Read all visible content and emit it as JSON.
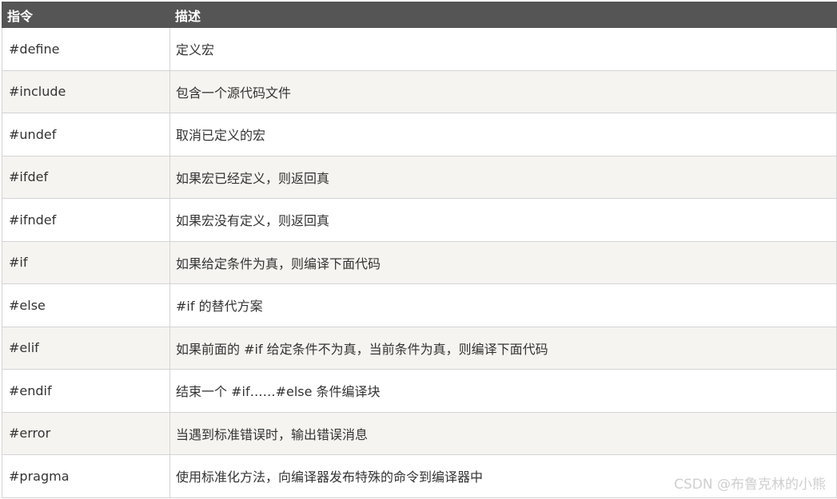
{
  "table": {
    "headers": [
      "指令",
      "描述"
    ],
    "rows": [
      {
        "directive": "#define",
        "description": "定义宏"
      },
      {
        "directive": "#include",
        "description": "包含一个源代码文件"
      },
      {
        "directive": "#undef",
        "description": "取消已定义的宏"
      },
      {
        "directive": "#ifdef",
        "description": "如果宏已经定义，则返回真"
      },
      {
        "directive": "#ifndef",
        "description": "如果宏没有定义，则返回真"
      },
      {
        "directive": "#if",
        "description": "如果给定条件为真，则编译下面代码"
      },
      {
        "directive": "#else",
        "description": "#if 的替代方案"
      },
      {
        "directive": "#elif",
        "description": "如果前面的 #if 给定条件不为真，当前条件为真，则编译下面代码"
      },
      {
        "directive": "#endif",
        "description": "结束一个 #if……#else 条件编译块"
      },
      {
        "directive": "#error",
        "description": "当遇到标准错误时，输出错误消息"
      },
      {
        "directive": "#pragma",
        "description": "使用标准化方法，向编译器发布特殊的命令到编译器中"
      }
    ]
  },
  "watermark": "CSDN @布鲁克林的小熊",
  "colors": {
    "header_bg": "#555555",
    "header_text": "#ffffff",
    "row_alt_bg": "#f5f4f0",
    "border": "#d4d4d4",
    "text": "#333333"
  }
}
